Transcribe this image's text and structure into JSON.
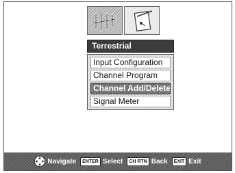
{
  "tabs": [
    {
      "name": "antenna",
      "icon": "antenna-icon",
      "active": true
    },
    {
      "name": "setup",
      "icon": "tools-icon",
      "active": false
    }
  ],
  "menu": {
    "title": "Terrestrial",
    "items": [
      {
        "label": "Input Configuration",
        "selected": false
      },
      {
        "label": "Channel Program",
        "selected": false
      },
      {
        "label": "Channel Add/Delete",
        "selected": true
      },
      {
        "label": "Signal Meter",
        "selected": false
      }
    ]
  },
  "footer": {
    "navigate_label": "Navigate",
    "enter_key": "ENTER",
    "select_label": "Select",
    "return_key": "CH RTN",
    "back_label": "Back",
    "exit_key": "EXIT",
    "exit_label": "Exit"
  }
}
